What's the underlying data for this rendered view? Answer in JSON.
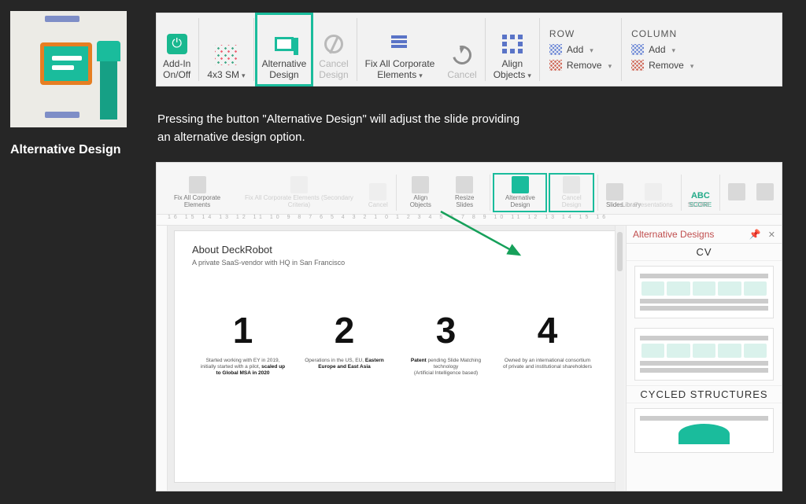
{
  "feature": {
    "title": "Alternative Design"
  },
  "ribbon": {
    "addin": "Add-In\nOn/Off",
    "fourx3": "4x3 SM",
    "alt": "Alternative\nDesign",
    "cancel": "Cancel\nDesign",
    "fixall": "Fix All Corporate\nElements",
    "cancel2": "Cancel",
    "align": "Align\nObjects",
    "row_head": "ROW",
    "row_add": "Add",
    "row_remove": "Remove",
    "col_head": "COLUMN",
    "col_add": "Add",
    "col_remove": "Remove"
  },
  "description": {
    "l1": "Pressing the button \"Alternative Design\" will adjust the slide providing",
    "l2": "an alternative design option."
  },
  "ppt": {
    "mini": {
      "fixall": "Fix All Corporate\nElements",
      "fixall_dim": "Fix All Corporate Elements\n(Secondary Criteria)",
      "cancel_dim": "Cancel",
      "align": "Align\nObjects",
      "resize": "Resize\nSlides",
      "alt": "Alternative\nDesign",
      "cancel": "Cancel\nDesign",
      "slides": "Slides",
      "present_dim": "Presentations",
      "abc": "ABC",
      "score": "SCORE",
      "section_library": "Library",
      "section_score": "SCORE"
    },
    "ruler": "16 15 14 13 12 11 10 9 8 7 6 5 4 3 2 1 0 1 2 3 4 5 6 7 8 9 10 11 12 13 14 15 16",
    "slide": {
      "title": "About DeckRobot",
      "subtitle": "A private SaaS-vendor with HQ in San Francisco",
      "c1n": "1",
      "c1t_a": "Started working with EY in 2019,",
      "c1t_b": "initially started with a pilot,",
      "c1t_c": "scaled up to Global MSA in 2020",
      "c2n": "2",
      "c2t_a": "Operations in the US, EU,",
      "c2t_b": "Eastern Europe and East Asia",
      "c3n": "3",
      "c3t_a": "Patent",
      "c3t_b": "pending Slide Matching",
      "c3t_c": "technology",
      "c3t_d": "(Artificial Intelligence based)",
      "c4n": "4",
      "c4t_a": "Owned by an international consortium",
      "c4t_b": "of private and institutional",
      "c4t_c": "shareholders"
    },
    "panel": {
      "title": "Alternative Designs",
      "pin": "📌",
      "close": "✕",
      "sect1": "CV",
      "sect2": "CYCLED STRUCTURES"
    }
  }
}
